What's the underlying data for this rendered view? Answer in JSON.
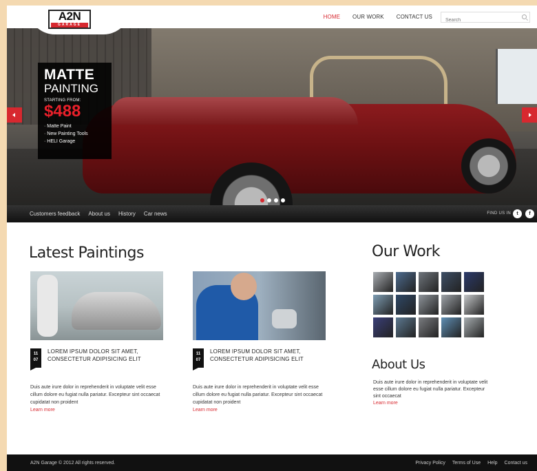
{
  "header": {
    "logo_text": "A2N",
    "logo_sub": "GARAGE",
    "nav": [
      "HOME",
      "OUR WORK",
      "CONTACT US"
    ],
    "search_placeholder": "Search"
  },
  "hero": {
    "promo": {
      "title_line1": "MATTE",
      "title_line2": "PAINTING",
      "starting_from": "STARTING FROM:",
      "price": "$488",
      "features": [
        "Matte Paint",
        "New Painting Tools",
        "HELI Garage"
      ]
    },
    "slides": 4,
    "active_slide": 1
  },
  "subbar": {
    "links": [
      "Customers feedback",
      "About us",
      "History",
      "Car news"
    ],
    "find_us": "FIND US IN",
    "social": [
      "twitter",
      "facebook"
    ]
  },
  "latest": {
    "heading": "Latest Paintings",
    "posts": [
      {
        "day": "11",
        "month": "07",
        "title": "LOREM IPSUM DOLOR SIT AMET, CONSECTETUR ADIPISICING ELIT",
        "text": "Duis aute irure dolor in reprehenderit in voluptate velit esse cillum dolore eu fugiat nulla pariatur. Excepteur sint occaecat cupidatat non proident",
        "learn_more": "Learn more"
      },
      {
        "day": "11",
        "month": "07",
        "title": "LOREM IPSUM DOLOR SIT AMET, CONSECTETUR ADIPISICING ELIT",
        "text": "Duis aute irure dolor in reprehenderit in voluptate velit esse cillum dolore eu fugiat nulla pariatur. Excepteur sint occaecat cupidatat non proident",
        "learn_more": "Learn more"
      }
    ]
  },
  "our_work": {
    "heading": "Our Work",
    "thumbnail_colors": [
      "#a9adb2",
      "#4d6b8e",
      "#6f757c",
      "#3e4f66",
      "#2b3a6a",
      "#7e9db3",
      "#2f4866",
      "#8e949a",
      "#9ea3a8",
      "#c4c6c8",
      "#3a3f78",
      "#5c7890",
      "#7a7c80",
      "#5f8fb4",
      "#a7adb0"
    ]
  },
  "about": {
    "heading": "About Us",
    "text": "Duis aute irure dolor in reprehenderit in voluptate velit esse cillum dolore eu fugiat nulla pariatur. Excepteur sint occaecat",
    "learn_more": "Learn more"
  },
  "footer": {
    "copyright": "A2N Garage © 2012 All rights reserved.",
    "links": [
      "Privacy Policy",
      "Terms of Use",
      "Help",
      "Contact us"
    ]
  },
  "colors": {
    "accent": "#d7282f",
    "background": "#f4d9b1",
    "dark": "#111111"
  }
}
